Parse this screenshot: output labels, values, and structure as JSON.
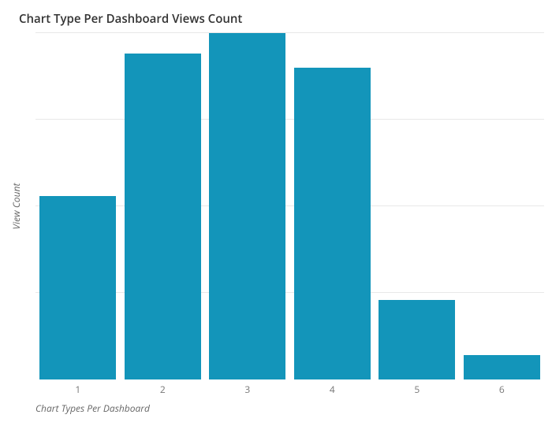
{
  "chart_data": {
    "type": "bar",
    "title": "Chart Type Per Dashboard Views Count",
    "xlabel": "Chart Types Per Dashboard",
    "ylabel": "View Count",
    "categories": [
      "1",
      "2",
      "3",
      "4",
      "5",
      "6"
    ],
    "values": [
      53,
      94,
      100,
      90,
      23,
      7
    ],
    "ylim": [
      0,
      100
    ],
    "gridlines": [
      25,
      50,
      75,
      100
    ],
    "bar_color": "#1395ba"
  }
}
